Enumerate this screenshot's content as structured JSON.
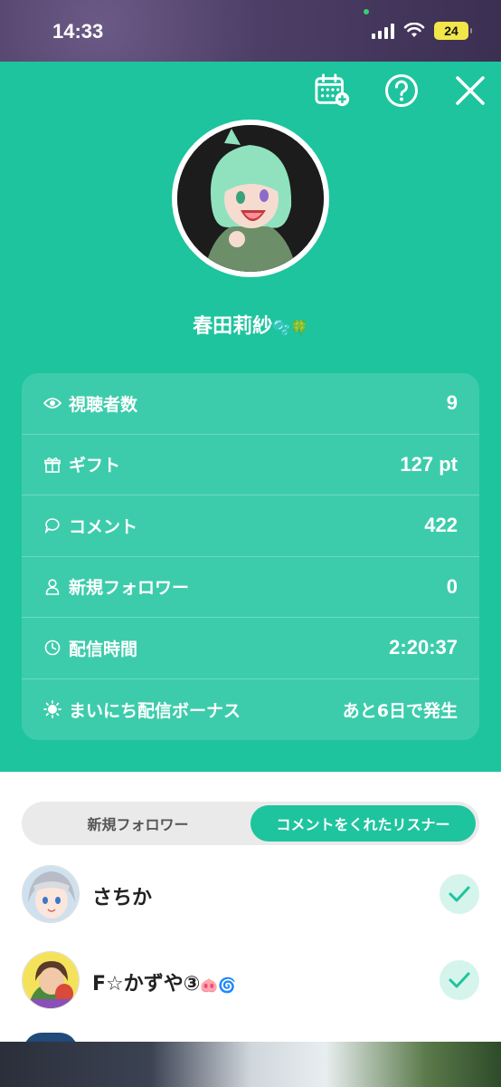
{
  "status_bar": {
    "time": "14:33",
    "battery": "24"
  },
  "header": {
    "username": "春田莉紗",
    "username_emoji": "🫧🍀"
  },
  "stats": [
    {
      "icon": "eye-icon",
      "label": "視聴者数",
      "value": "9"
    },
    {
      "icon": "gift-icon",
      "label": "ギフト",
      "value": "127 pt"
    },
    {
      "icon": "comment-icon",
      "label": "コメント",
      "value": "422"
    },
    {
      "icon": "person-icon",
      "label": "新規フォロワー",
      "value": "0"
    },
    {
      "icon": "clock-icon",
      "label": "配信時間",
      "value": "2:20:37"
    },
    {
      "icon": "sun-icon",
      "label": "まいにち配信ボーナス",
      "value": "あと6日で発生"
    }
  ],
  "tabs": {
    "left": "新規フォロワー",
    "right": "コメントをくれたリスナー",
    "active": "right"
  },
  "listeners": [
    {
      "name": "さちか"
    },
    {
      "name": "F☆かずや③",
      "emoji": "🐽🌀"
    }
  ],
  "colors": {
    "accent": "#1ec49e",
    "check_bg": "#d5f4ec"
  }
}
